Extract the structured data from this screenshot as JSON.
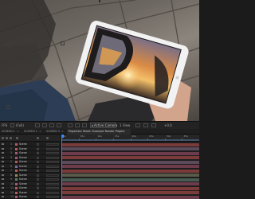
{
  "viewer": {
    "description_colors": {
      "accent": "#3b8cff"
    }
  },
  "viewer_toolbar": {
    "zoom": "(Full)",
    "label_left": "FPS",
    "camera": "Active Camera",
    "views": "1 View",
    "exposure": "+0.0"
  },
  "tabs": [
    {
      "label": "SCREEN 1"
    },
    {
      "label": "SCREEN 2"
    },
    {
      "label": "SCREEN 3"
    },
    {
      "label": "Projection Sheet: Example Render Project"
    }
  ],
  "layers": [
    {
      "index": "1",
      "name": "Scene",
      "color": "#b35c5c"
    },
    {
      "index": "2",
      "name": "Scene",
      "color": "#b35c5c"
    },
    {
      "index": "3",
      "name": "Scene",
      "color": "#a35a7a"
    },
    {
      "index": "4",
      "name": "Scene",
      "color": "#a35a7a"
    },
    {
      "index": "5",
      "name": "Scene",
      "color": "#b35c5c"
    },
    {
      "index": "6",
      "name": "Scene",
      "color": "#7b6d9a"
    },
    {
      "index": "7",
      "name": "Scene",
      "color": "#b35c5c"
    },
    {
      "index": "8",
      "name": "Scene",
      "color": "#8e8e5e"
    },
    {
      "index": "9",
      "name": "Scene",
      "color": "#5e7e6e"
    },
    {
      "index": "10",
      "name": "Scene",
      "color": "#a35a7a"
    },
    {
      "index": "11",
      "name": "Scene",
      "color": "#b35c5c"
    },
    {
      "index": "12",
      "name": "Scene",
      "color": "#b35c5c"
    },
    {
      "index": "13",
      "name": "Scene",
      "color": "#a35a7a"
    }
  ],
  "ruler": {
    "labels": [
      "0s",
      "05s",
      "10s",
      "15s",
      "20s",
      "25s",
      "30s",
      "35s"
    ]
  },
  "track_colors": [
    "#7a3b3b",
    "#5a4a5a",
    "#6c3b4c",
    "#7a3b3b",
    "#5a4a5a",
    "#6c3b4c",
    "#7a3b3b",
    "#5a5a48",
    "#495a52",
    "#6c3b4c",
    "#7a3b3b",
    "#7a3b3b",
    "#6c3b4c"
  ]
}
